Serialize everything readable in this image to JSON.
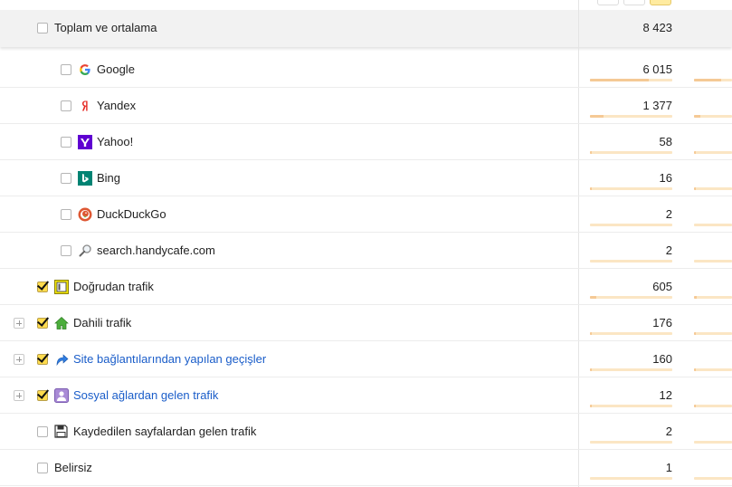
{
  "total": {
    "label": "Toplam ve ortalama",
    "value": "8 423"
  },
  "rows": [
    {
      "label": "Google",
      "value": "6 015",
      "icon": "google-icon",
      "share": 0.714
    },
    {
      "label": "Yandex",
      "value": "1 377",
      "icon": "yandex-icon",
      "share": 0.163
    },
    {
      "label": "Yahoo!",
      "value": "58",
      "icon": "yahoo-icon",
      "share": 0.007
    },
    {
      "label": "Bing",
      "value": "16",
      "icon": "bing-icon",
      "share": 0.002
    },
    {
      "label": "DuckDuckGo",
      "value": "2",
      "icon": "duckduckgo-icon",
      "share": 0.0
    },
    {
      "label": "search.handycafe.com",
      "value": "2",
      "icon": "magnifier-icon",
      "share": 0.0
    },
    {
      "label": "Doğrudan trafik",
      "value": "605",
      "icon": "direct-traffic-icon",
      "share": 0.072
    },
    {
      "label": "Dahili trafik",
      "value": "176",
      "icon": "home-icon",
      "share": 0.021
    },
    {
      "label": "Site bağlantılarından yapılan geçişler",
      "value": "160",
      "icon": "link-arrow-icon",
      "share": 0.019
    },
    {
      "label": "Sosyal ağlardan gelen trafik",
      "value": "12",
      "icon": "social-person-icon",
      "share": 0.001
    },
    {
      "label": "Kaydedilen sayfalardan gelen trafik",
      "value": "2",
      "icon": "floppy-disk-icon",
      "share": 0.0
    },
    {
      "label": "Belirsiz",
      "value": "1",
      "icon": "",
      "share": 0.0
    }
  ],
  "colors": {
    "bar_track": "#fbe6c4",
    "bar_fill": "#f5c995",
    "checkbox_checked": "#ffdb4d",
    "link": "#1a5dc9"
  }
}
